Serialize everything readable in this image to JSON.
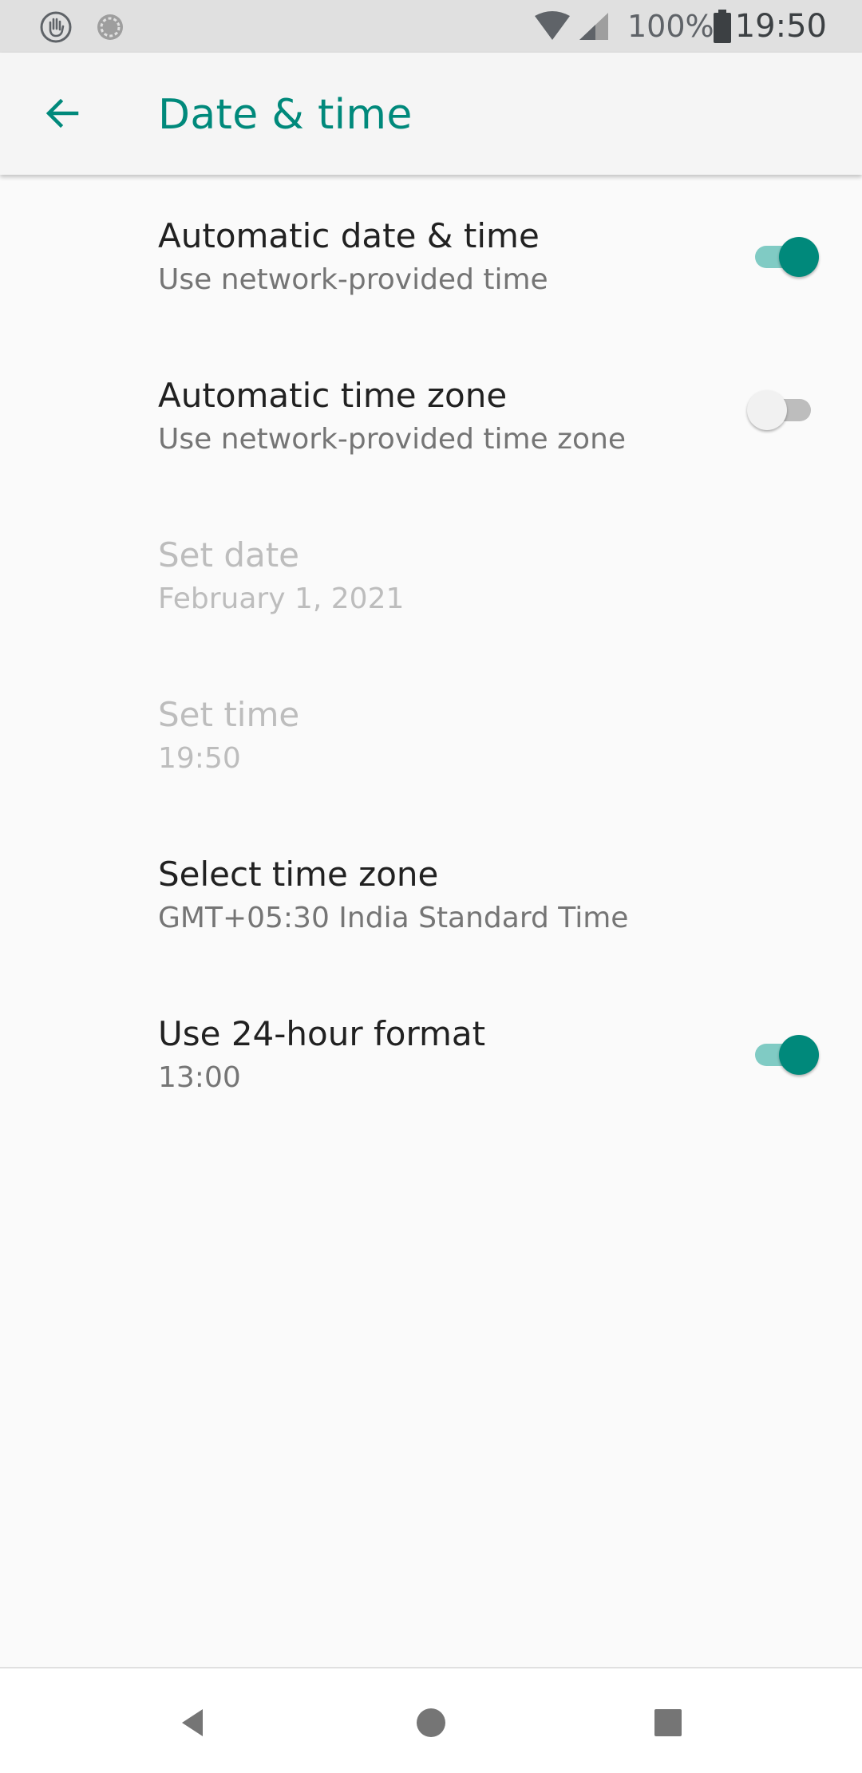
{
  "status_bar": {
    "battery_percent": "100%",
    "time": "19:50",
    "icons": [
      "hand-icon",
      "sync-icon",
      "wifi-icon",
      "signal-icon",
      "battery-icon"
    ]
  },
  "app_bar": {
    "title": "Date & time",
    "back_icon": "arrow-back-icon"
  },
  "settings": [
    {
      "title": "Automatic date & time",
      "summary": "Use network-provided time",
      "has_switch": true,
      "checked": true,
      "enabled": true
    },
    {
      "title": "Automatic time zone",
      "summary": "Use network-provided time zone",
      "has_switch": true,
      "checked": false,
      "enabled": true
    },
    {
      "title": "Set date",
      "summary": "February 1, 2021",
      "has_switch": false,
      "enabled": false
    },
    {
      "title": "Set time",
      "summary": "19:50",
      "has_switch": false,
      "enabled": false
    },
    {
      "title": "Select time zone",
      "summary": "GMT+05:30 India Standard Time",
      "has_switch": false,
      "enabled": true
    },
    {
      "title": "Use 24-hour format",
      "summary": "13:00",
      "has_switch": true,
      "checked": true,
      "enabled": true
    }
  ],
  "nav_bar": {
    "icons": [
      "back-triangle-icon",
      "home-circle-icon",
      "recents-square-icon"
    ]
  },
  "colors": {
    "accent": "#00897b",
    "accent_light": "#80cbc4",
    "status_bar_bg": "#e0e0e0",
    "background": "#fafafa"
  }
}
